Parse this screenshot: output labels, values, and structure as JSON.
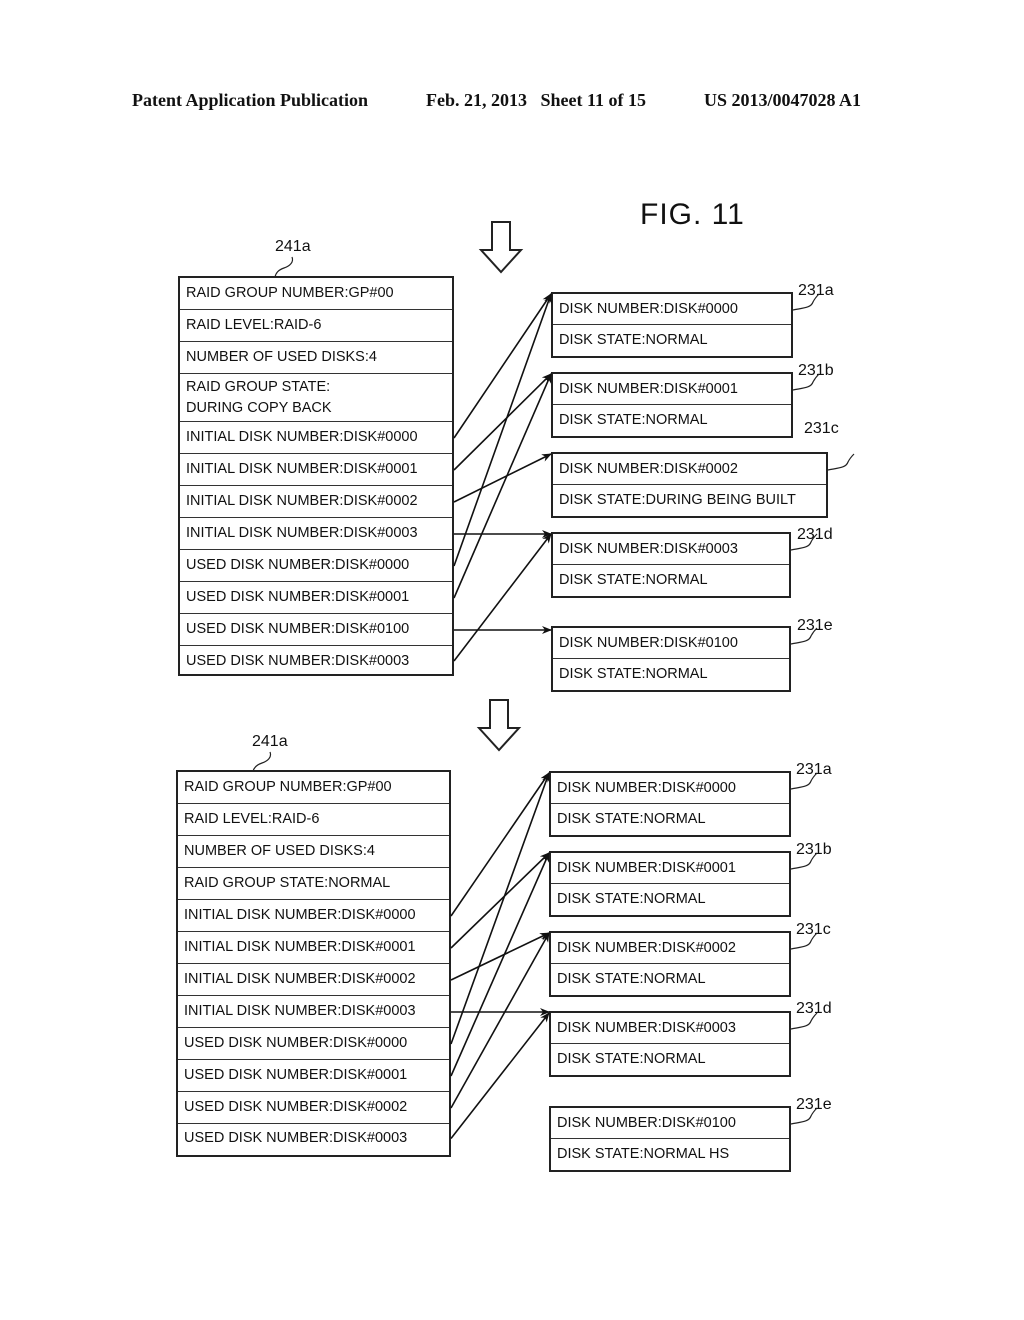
{
  "header": {
    "publication": "Patent Application Publication",
    "date_sheet": "Feb. 21, 2013   Sheet 11 of 15",
    "number": "US 2013/0047028 A1"
  },
  "figure_title": "FIG. 11",
  "panels": [
    {
      "group_ref": "241a",
      "group_rows": [
        "RAID GROUP NUMBER:GP#00",
        "RAID LEVEL:RAID-6",
        "NUMBER OF USED DISKS:4",
        "RAID GROUP STATE:\nDURING COPY BACK",
        "INITIAL DISK NUMBER:DISK#0000",
        "INITIAL DISK NUMBER:DISK#0001",
        "INITIAL DISK NUMBER:DISK#0002",
        "INITIAL DISK NUMBER:DISK#0003",
        "USED DISK NUMBER:DISK#0000",
        "USED DISK NUMBER:DISK#0001",
        "USED DISK NUMBER:DISK#0100",
        "USED DISK NUMBER:DISK#0003"
      ],
      "disks": [
        {
          "ref": "231a",
          "number": "DISK NUMBER:DISK#0000",
          "state": "DISK STATE:NORMAL"
        },
        {
          "ref": "231b",
          "number": "DISK NUMBER:DISK#0001",
          "state": "DISK STATE:NORMAL"
        },
        {
          "ref": "231c",
          "number": "DISK NUMBER:DISK#0002",
          "state": "DISK STATE:DURING BEING BUILT"
        },
        {
          "ref": "231d",
          "number": "DISK NUMBER:DISK#0003",
          "state": "DISK STATE:NORMAL"
        },
        {
          "ref": "231e",
          "number": "DISK NUMBER:DISK#0100",
          "state": "DISK STATE:NORMAL"
        }
      ],
      "links": [
        [
          4,
          0
        ],
        [
          5,
          1
        ],
        [
          6,
          2
        ],
        [
          7,
          3
        ],
        [
          8,
          0
        ],
        [
          9,
          1
        ],
        [
          10,
          4
        ],
        [
          11,
          3
        ]
      ]
    },
    {
      "group_ref": "241a",
      "group_rows": [
        "RAID GROUP NUMBER:GP#00",
        "RAID LEVEL:RAID-6",
        "NUMBER OF USED DISKS:4",
        "RAID GROUP STATE:NORMAL",
        "INITIAL DISK NUMBER:DISK#0000",
        "INITIAL DISK NUMBER:DISK#0001",
        "INITIAL DISK NUMBER:DISK#0002",
        "INITIAL DISK NUMBER:DISK#0003",
        "USED DISK NUMBER:DISK#0000",
        "USED DISK NUMBER:DISK#0001",
        "USED DISK NUMBER:DISK#0002",
        "USED DISK NUMBER:DISK#0003"
      ],
      "disks": [
        {
          "ref": "231a",
          "number": "DISK NUMBER:DISK#0000",
          "state": "DISK STATE:NORMAL"
        },
        {
          "ref": "231b",
          "number": "DISK NUMBER:DISK#0001",
          "state": "DISK STATE:NORMAL"
        },
        {
          "ref": "231c",
          "number": "DISK NUMBER:DISK#0002",
          "state": "DISK STATE:NORMAL"
        },
        {
          "ref": "231d",
          "number": "DISK NUMBER:DISK#0003",
          "state": "DISK STATE:NORMAL"
        },
        {
          "ref": "231e",
          "number": "DISK NUMBER:DISK#0100",
          "state": "DISK STATE:NORMAL HS"
        }
      ],
      "links": [
        [
          4,
          0
        ],
        [
          5,
          1
        ],
        [
          6,
          2
        ],
        [
          7,
          3
        ],
        [
          8,
          0
        ],
        [
          9,
          1
        ],
        [
          10,
          2
        ],
        [
          11,
          3
        ]
      ]
    }
  ]
}
